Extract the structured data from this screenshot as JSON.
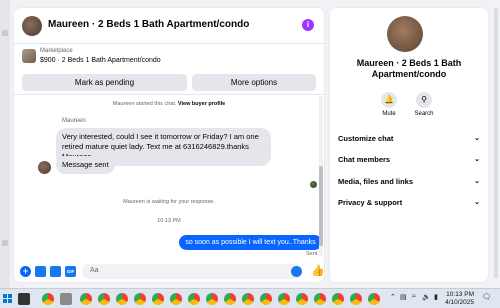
{
  "chat": {
    "title": "Maureen · 2 Beds 1 Bath Apartment/condo",
    "listing_label": "Marketplace",
    "listing_price": "$900 · 2 Beds 1 Bath Apartment/condo",
    "mark_pending_label": "Mark as pending",
    "more_options_label": "More options",
    "started_text": "Maureen started this chat.",
    "view_profile_label": "View buyer profile",
    "sender_name": "Maureen",
    "message_1": "Very interested, could I see it tomorrow or Friday? I am one retired mature quiet lady. Text me at 6316246829.thanks Maureen",
    "message_2": "Message sent",
    "waiting_text": "Maureen is waiting for your response.",
    "timestamp": "10:13 PM",
    "outgoing_message": "so soon as possible I will text you..Thanks",
    "sent_status": "Sent",
    "composer_placeholder": "Aa",
    "icons": [
      "plus-icon",
      "photo-icon",
      "sticker-icon",
      "gif-icon",
      "emoji-icon",
      "like-icon",
      "info-icon"
    ],
    "gif_label": "GIF"
  },
  "details": {
    "name": "Maureen · 2 Beds 1 Bath Apartment/condo",
    "mute_label": "Mute",
    "search_label": "Search",
    "sections": [
      "Customize chat",
      "Chat members",
      "Media, files and links",
      "Privacy & support"
    ]
  },
  "taskbar": {
    "time": "10:13 PM",
    "date": "4/10/2025"
  },
  "colors": {
    "accent": "#0866ff",
    "bubble_in": "#e4e6eb",
    "info": "#a033ff"
  }
}
